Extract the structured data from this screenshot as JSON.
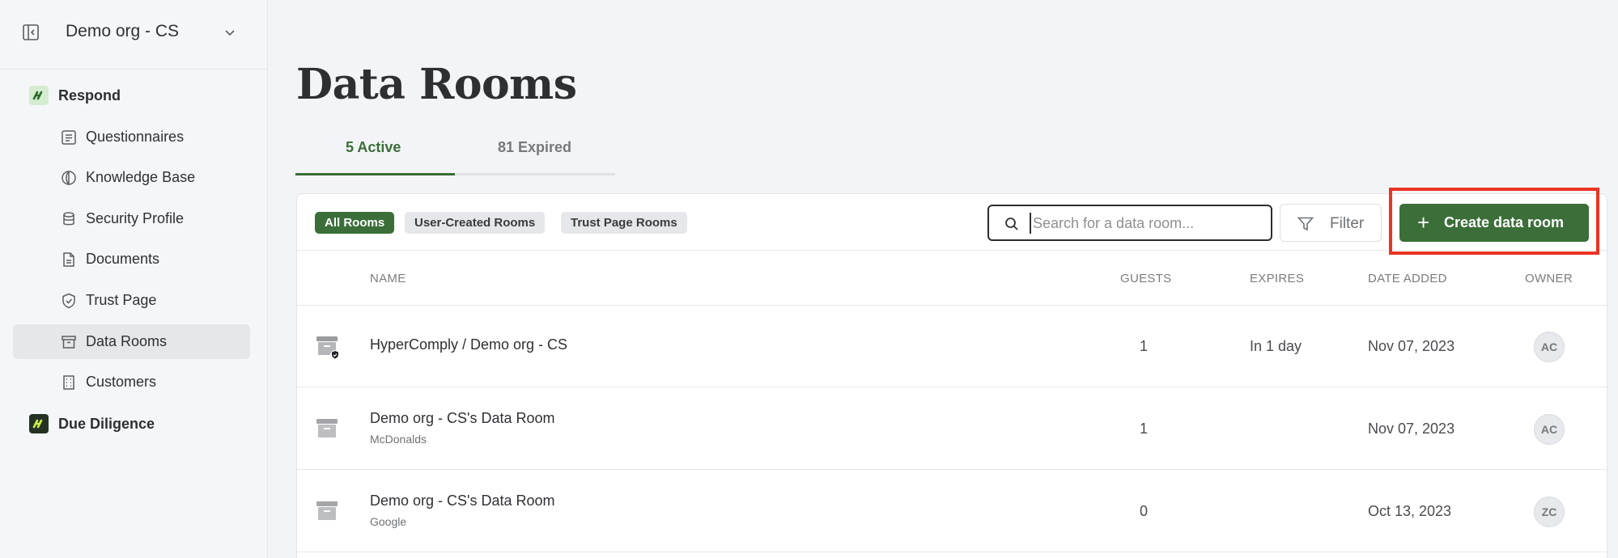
{
  "sidebar": {
    "org_name": "Demo org - CS",
    "groups": [
      {
        "label": "Respond",
        "icon": "respond-logo-icon"
      },
      {
        "label": "Due Diligence",
        "icon": "due-diligence-logo-icon"
      }
    ],
    "items": [
      {
        "label": "Questionnaires",
        "icon": "list-icon"
      },
      {
        "label": "Knowledge Base",
        "icon": "globe-icon"
      },
      {
        "label": "Security Profile",
        "icon": "database-icon"
      },
      {
        "label": "Documents",
        "icon": "document-icon"
      },
      {
        "label": "Trust Page",
        "icon": "shield-icon"
      },
      {
        "label": "Data Rooms",
        "icon": "archive-icon",
        "active": true
      },
      {
        "label": "Customers",
        "icon": "building-icon"
      }
    ]
  },
  "main": {
    "title": "Data Rooms",
    "tabs": [
      {
        "label": "5 Active",
        "active": true
      },
      {
        "label": "81 Expired",
        "active": false
      }
    ],
    "filters": [
      {
        "label": "All Rooms",
        "active": true
      },
      {
        "label": "User-Created Rooms",
        "active": false
      },
      {
        "label": "Trust Page Rooms",
        "active": false
      }
    ],
    "search": {
      "placeholder": "Search for a data room...",
      "value": ""
    },
    "filter_label": "Filter",
    "create_label": "Create data room",
    "columns": [
      "NAME",
      "GUESTS",
      "EXPIRES",
      "DATE ADDED",
      "OWNER"
    ],
    "rows": [
      {
        "name": "HyperComply / Demo org - CS",
        "sub": "",
        "guests": "1",
        "expires": "In 1 day",
        "date": "Nov 07, 2023",
        "owner": "AC",
        "icon": "data-room-shield-icon"
      },
      {
        "name": "Demo org - CS's Data Room",
        "sub": "McDonalds",
        "guests": "1",
        "expires": "",
        "date": "Nov 07, 2023",
        "owner": "AC",
        "icon": "data-room-icon"
      },
      {
        "name": "Demo org - CS's Data Room",
        "sub": "Google",
        "guests": "0",
        "expires": "",
        "date": "Oct 13, 2023",
        "owner": "ZC",
        "icon": "data-room-icon"
      }
    ]
  },
  "colors": {
    "accent": "#3b6e38",
    "highlight": "#ea3423",
    "background": "#f3f4f7"
  }
}
